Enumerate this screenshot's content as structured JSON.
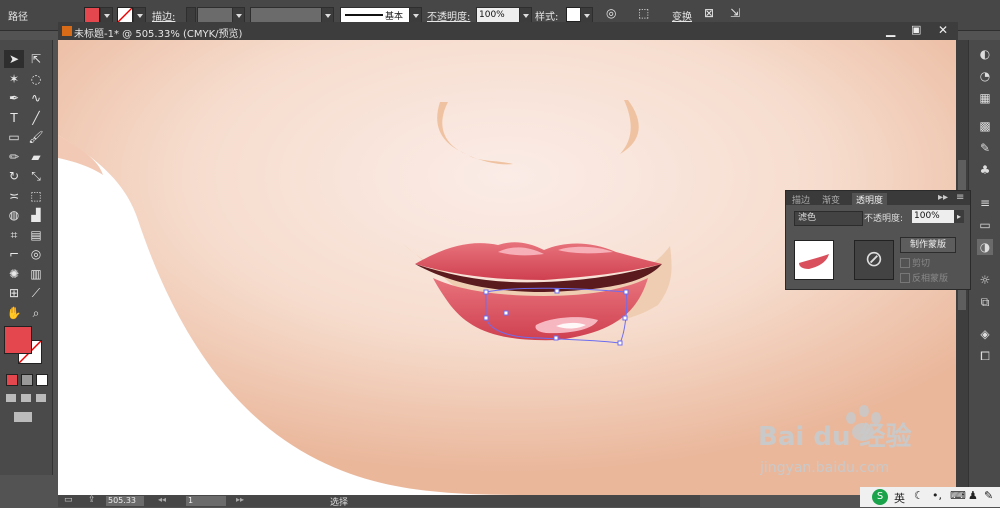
{
  "control_bar": {
    "object_type": "路径",
    "stroke_label": "描边:",
    "stroke_style": "基本",
    "opacity_label": "不透明度:",
    "opacity_value": "100%",
    "style_label": "样式:",
    "transform_label": "变换",
    "fill_color": "#e5474f"
  },
  "document": {
    "title": "未标题-1* @ 505.33% (CMYK/预览)"
  },
  "status_bar": {
    "zoom": "505.33",
    "page": "1",
    "tool": "选择"
  },
  "toolbar": {
    "tools": [
      "selection-tool",
      "direct-selection-tool",
      "magic-wand-tool",
      "lasso-tool",
      "pen-tool",
      "curvature-tool",
      "type-tool",
      "line-tool",
      "rectangle-tool",
      "paintbrush-tool",
      "pencil-tool",
      "eraser-tool",
      "rotate-tool",
      "scale-tool",
      "width-tool",
      "free-transform-tool",
      "shape-builder-tool",
      "perspective-grid-tool",
      "mesh-tool",
      "gradient-tool",
      "eyedropper-tool",
      "blend-tool",
      "symbol-sprayer-tool",
      "column-graph-tool",
      "artboard-tool",
      "slice-tool",
      "hand-tool",
      "zoom-tool"
    ],
    "fill_color": "#e5474f"
  },
  "transparency_panel": {
    "tabs": [
      "描边",
      "渐变",
      "透明度"
    ],
    "blend_mode": "滤色",
    "opacity_label": "不透明度:",
    "opacity_value": "100%",
    "make_mask_button": "制作蒙版",
    "clip_label": "剪切",
    "invert_mask_label": "反相蒙版"
  },
  "watermark": {
    "brand": "Bai du 经验",
    "url": "jingyan.baidu.com"
  },
  "taskbar": {
    "ime": "英"
  },
  "colors": {
    "skin": "#f3d9c8",
    "lip": "#d9505c",
    "lip_highlight": "#f7b7c1",
    "mouth_dark": "#5a1a1e",
    "selection": "#6d6df0"
  }
}
